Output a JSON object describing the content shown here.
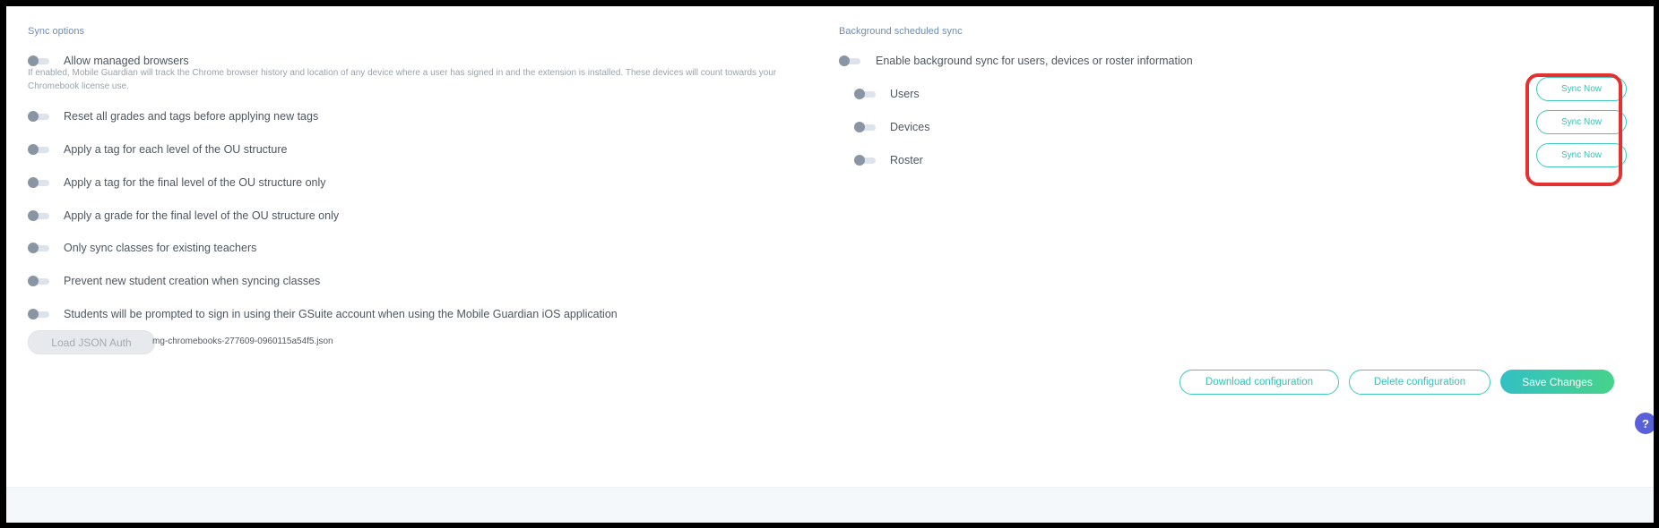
{
  "sync_options": {
    "title": "Sync options",
    "items": [
      {
        "label": "Allow managed browsers",
        "enabled": false,
        "description": "If enabled, Mobile Guardian will track the Chrome browser history and location of any device where a user has signed in and the extension is installed. These devices will count towards your Chromebook license use."
      },
      {
        "label": "Reset all grades and tags before applying new tags",
        "enabled": false
      },
      {
        "label": "Apply a tag for each level of the OU structure",
        "enabled": false
      },
      {
        "label": "Apply a tag for the final level of the OU structure only",
        "enabled": false
      },
      {
        "label": "Apply a grade for the final level of the OU structure only",
        "enabled": false
      },
      {
        "label": "Only sync classes for existing teachers",
        "enabled": false
      },
      {
        "label": "Prevent new student creation when syncing classes",
        "enabled": false
      },
      {
        "label": "Students will be prompted to sign in using their GSuite account when using the Mobile Guardian iOS application",
        "enabled": false
      }
    ],
    "load_json_button": "Load JSON Auth",
    "json_filename": "mg-chromebooks-277609-0960115a54f5.json"
  },
  "background_sync": {
    "title": "Background scheduled sync",
    "main_toggle_label": "Enable background sync for users, devices or roster information",
    "main_toggle_enabled": false,
    "items": [
      {
        "label": "Users",
        "enabled": false,
        "button": "Sync Now"
      },
      {
        "label": "Devices",
        "enabled": false,
        "button": "Sync Now"
      },
      {
        "label": "Roster",
        "enabled": false,
        "button": "Sync Now"
      }
    ]
  },
  "actions": {
    "download": "Download configuration",
    "delete": "Delete configuration",
    "save": "Save Changes"
  },
  "help": {
    "label": "?"
  },
  "colors": {
    "accent": "#3fc7bb",
    "section_title": "#6f8db1",
    "highlight": "#e53030",
    "help": "#5a60d8"
  }
}
